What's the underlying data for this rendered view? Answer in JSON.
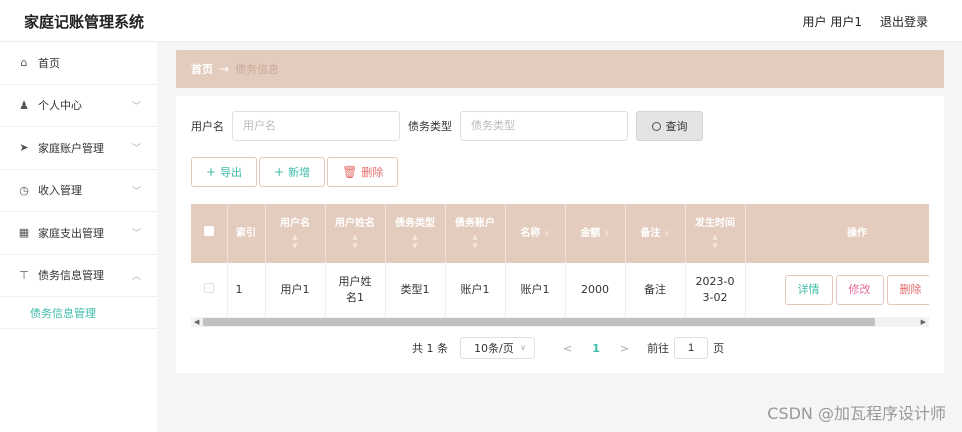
{
  "app": {
    "title": "家庭记账管理系统"
  },
  "header": {
    "user": "用户 用户1",
    "logout": "退出登录"
  },
  "sidebar": {
    "items": [
      {
        "label": "首页",
        "icon": "home-icon",
        "glyph": "⌂"
      },
      {
        "label": "个人中心",
        "icon": "user-icon",
        "glyph": "♟"
      },
      {
        "label": "家庭账户管理",
        "icon": "send-icon",
        "glyph": "➤"
      },
      {
        "label": "收入管理",
        "icon": "clock-icon",
        "glyph": "◷"
      },
      {
        "label": "家庭支出管理",
        "icon": "grid-icon",
        "glyph": "▦"
      },
      {
        "label": "债务信息管理",
        "icon": "pushpin-icon",
        "glyph": "⊤"
      }
    ],
    "submenu": {
      "label": "债务信息管理"
    }
  },
  "breadcrumb": {
    "home": "首页",
    "arrow": "→",
    "current": "债务信息"
  },
  "search": {
    "username_label": "用户名",
    "username_placeholder": "用户名",
    "type_label": "债务类型",
    "type_placeholder": "债务类型",
    "query_button": "查询"
  },
  "actions": {
    "export": "导出",
    "add": "新增",
    "delete": "删除",
    "plus": "+",
    "trash": "🗑"
  },
  "table": {
    "columns": [
      "索引",
      "用户名",
      "用户姓名",
      "债务类型",
      "债务账户",
      "名称",
      "金额",
      "备注",
      "发生时间",
      "操作"
    ],
    "rows": [
      {
        "index": "1",
        "username": "用户1",
        "name": "用户姓名1",
        "debt_type": "类型1",
        "debt_account": "账户1",
        "title": "账户1",
        "amount": "2000",
        "remark": "备注",
        "time": "2023-03-02",
        "detail_btn": "详情",
        "edit_btn": "修改",
        "delete_btn": "删除"
      }
    ]
  },
  "pager": {
    "total": "共 1 条",
    "page_size": "10条/页",
    "prev": "<",
    "current": "1",
    "next": ">",
    "goto_label": "前往",
    "goto_value": "1",
    "page_suffix": "页"
  },
  "watermark": "CSDN @加瓦程序设计师",
  "colors": {
    "accent": "#3dbcaa",
    "header": "#e3cbbd",
    "danger": "#e36b6b",
    "edit": "#e36b9e"
  }
}
